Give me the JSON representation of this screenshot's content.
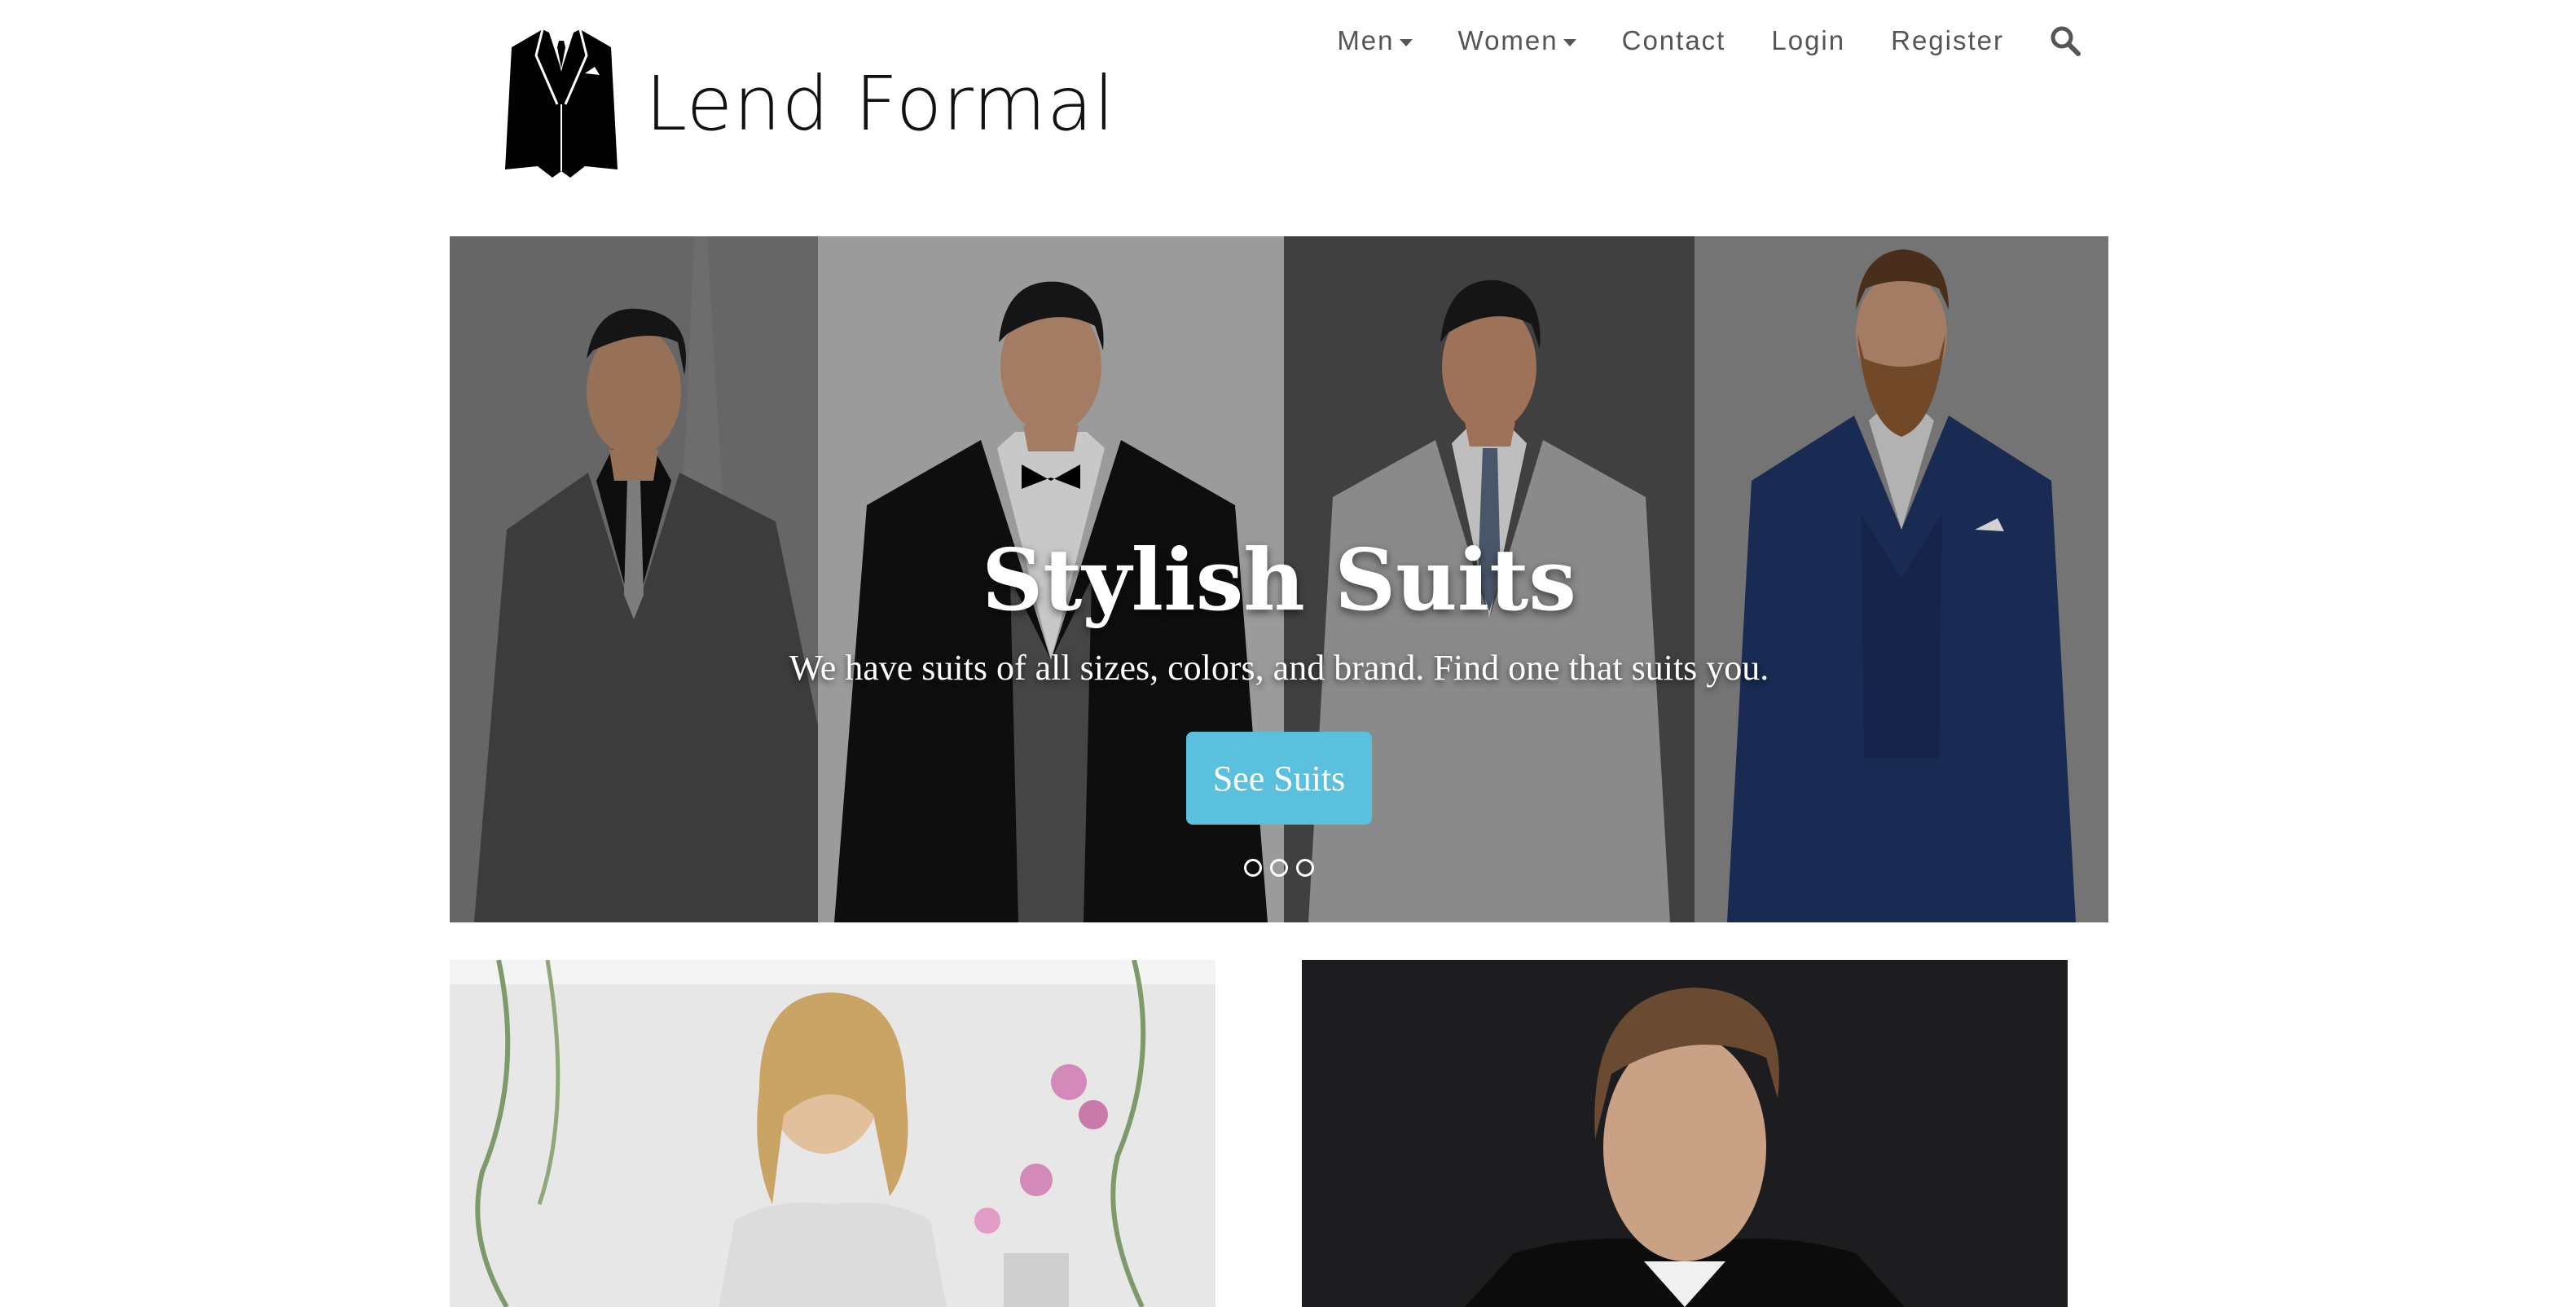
{
  "brand": {
    "name": "Lend Formal",
    "logo_icon": "suit-jacket-icon"
  },
  "nav": {
    "items": [
      {
        "label": "Men",
        "dropdown": true
      },
      {
        "label": "Women",
        "dropdown": true
      },
      {
        "label": "Contact",
        "dropdown": false
      },
      {
        "label": "Login",
        "dropdown": false
      },
      {
        "label": "Register",
        "dropdown": false
      }
    ],
    "search_icon": "search-icon"
  },
  "hero": {
    "title": "Stylish Suits",
    "subtitle": "We have suits of all sizes, colors, and brand. Find one that suits you.",
    "button_label": "See Suits",
    "slide_count": 3,
    "active_slide": 3,
    "button_color": "#5bc0de"
  },
  "colors": {
    "nav_text": "#555555",
    "brand_text": "#111111",
    "accent": "#5bc0de"
  }
}
